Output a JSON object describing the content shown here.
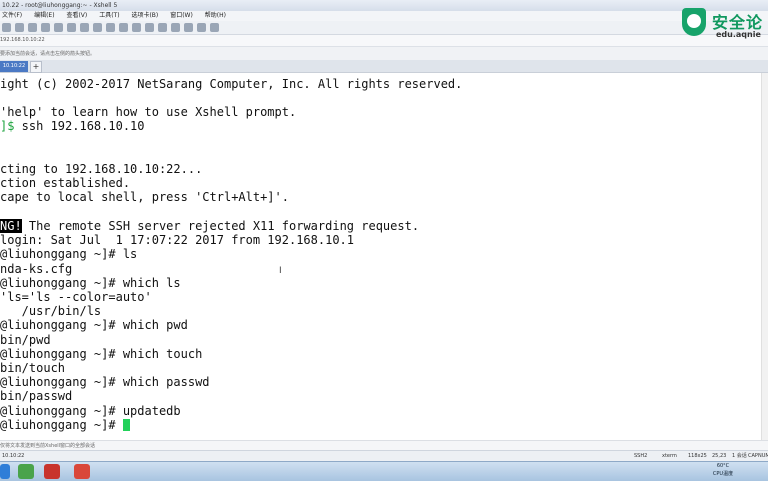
{
  "window": {
    "title": "10.22 - root@liuhonggang:~ - Xshell 5"
  },
  "menu": [
    "文件(F)",
    "编辑(E)",
    "查看(V)",
    "工具(T)",
    "选项卡(B)",
    "窗口(W)",
    "帮助(H)"
  ],
  "address": "192.168.10.10:22",
  "hint": "要添加当前会话，请点击左侧的箭头按钮。",
  "tabs": [
    {
      "label": "10.10:22"
    }
  ],
  "terminal": {
    "lines": [
      "ight (c) 2002-2017 NetSarang Computer, Inc. All rights reserved.",
      "",
      "'help' to learn how to use Xshell prompt.",
      "",
      "",
      "cting to 192.168.10.10:22...",
      "ction established.",
      "cape to local shell, press 'Ctrl+Alt+]'.",
      "",
      "",
      "login: Sat Jul  1 17:07:22 2017 from 192.168.10.1",
      "@liuhonggang ~]# ls",
      "nda-ks.cfg",
      "@liuhonggang ~]# which ls",
      "'ls='ls --color=auto'",
      "   /usr/bin/ls",
      "@liuhonggang ~]# which pwd",
      "bin/pwd",
      "@liuhonggang ~]# which touch",
      "bin/touch",
      "@liuhonggang ~]# which passwd",
      "bin/passwd",
      "@liuhonggang ~]# updatedb",
      "@liuhonggang ~]# "
    ],
    "ssh_prompt_suffix": "]$",
    "ssh_command": " ssh 192.168.10.10",
    "warning_tag": "NG!",
    "warning_text": " The remote SSH server rejected X11 forwarding request."
  },
  "hint_bottom": "仅将文本发送到当前Xshell窗口的全部会话",
  "status": {
    "left": "10.10:22",
    "protocol": "SSH2",
    "term": "xterm",
    "size": "118x25",
    "cursor_pos": "25,23",
    "sessions": "1 会话",
    "caps": "CAP",
    "num": "NUM"
  },
  "tray": {
    "temp": "60°C",
    "cpu": "CPU温度"
  },
  "logo": {
    "text": "安全论",
    "sub": "edu.aqnie"
  },
  "colors": {
    "prompt_green": "#1aa23b",
    "cursor": "#22d15a",
    "tab_active": "#4b79c4",
    "logo_green": "#10985f"
  }
}
